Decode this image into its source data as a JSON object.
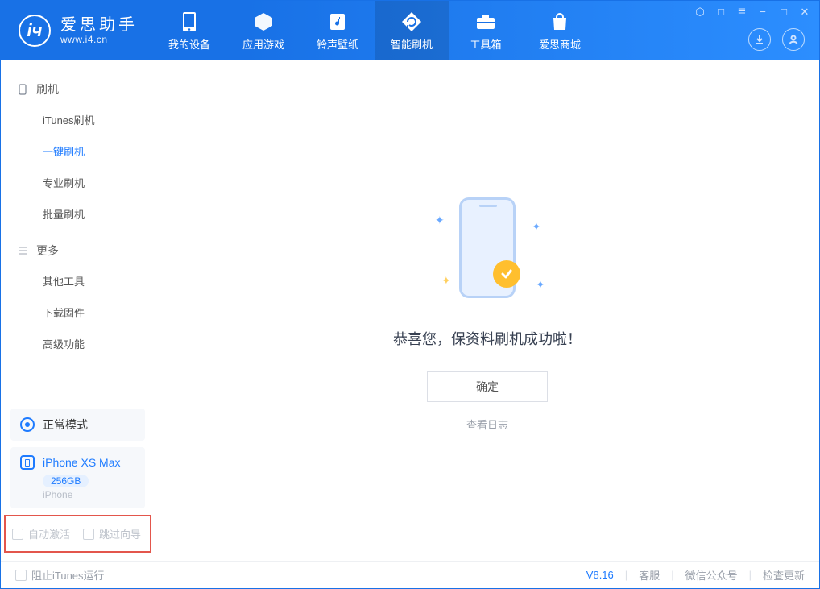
{
  "app": {
    "name_cn": "爱思助手",
    "url": "www.i4.cn"
  },
  "nav": {
    "items": [
      {
        "label": "我的设备"
      },
      {
        "label": "应用游戏"
      },
      {
        "label": "铃声壁纸"
      },
      {
        "label": "智能刷机"
      },
      {
        "label": "工具箱"
      },
      {
        "label": "爱思商城"
      }
    ],
    "active_index": 3
  },
  "win_controls": {
    "min": "−",
    "max": "□",
    "close": "✕",
    "skin": "⬡",
    "list": "≣",
    "grid": "□"
  },
  "sidebar": {
    "group1": {
      "title": "刷机",
      "items": [
        "iTunes刷机",
        "一键刷机",
        "专业刷机",
        "批量刷机"
      ],
      "active_index": 1
    },
    "group2": {
      "title": "更多",
      "items": [
        "其他工具",
        "下载固件",
        "高级功能"
      ]
    }
  },
  "mode": {
    "label": "正常模式"
  },
  "device": {
    "name": "iPhone XS Max",
    "capacity": "256GB",
    "type": "iPhone"
  },
  "checkboxes": {
    "auto_activate": "自动激活",
    "skip_wizard": "跳过向导"
  },
  "result": {
    "message": "恭喜您，保资料刷机成功啦！",
    "ok": "确定",
    "view_log": "查看日志"
  },
  "statusbar": {
    "block_itunes": "阻止iTunes运行",
    "version": "V8.16",
    "links": [
      "客服",
      "微信公众号",
      "检查更新"
    ]
  }
}
